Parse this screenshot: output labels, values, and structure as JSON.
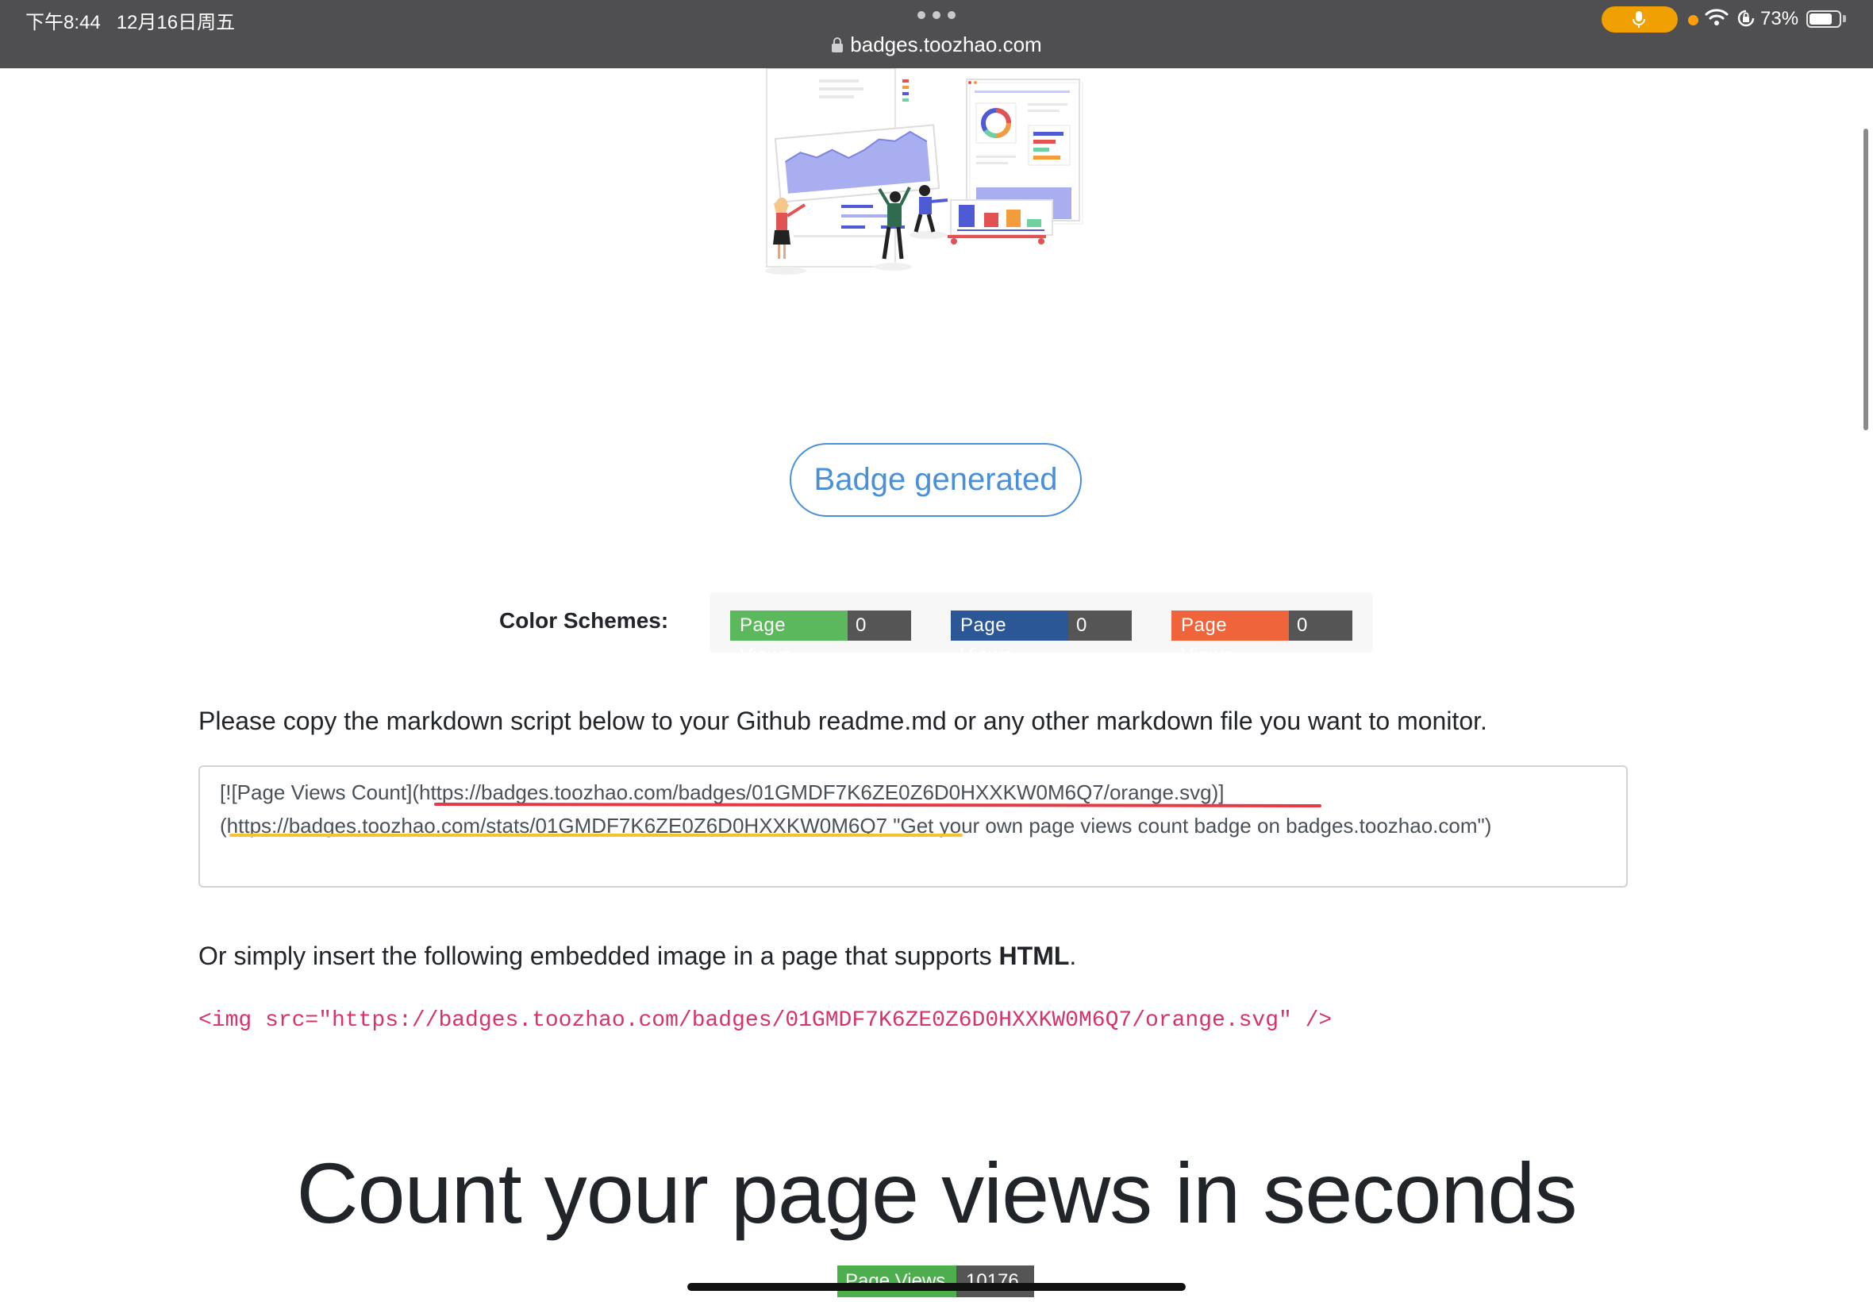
{
  "status_bar": {
    "time": "下午8:44   12月16日周五",
    "url": "badges.toozhao.com",
    "battery_percent": "73%",
    "battery_level": 0.73,
    "icons": [
      "lock-icon",
      "microphone-icon",
      "wifi-icon",
      "rotation-lock-icon",
      "battery-icon"
    ]
  },
  "main": {
    "badge_generated_button": "Badge generated",
    "color_schemes": {
      "label": "Color Schemes:",
      "badges": [
        {
          "label": "Page Views",
          "value": "0",
          "color": "#5cb85c"
        },
        {
          "label": "Page Views",
          "value": "0",
          "color": "#2b5797"
        },
        {
          "label": "Page Views",
          "value": "0",
          "color": "#f0643c"
        }
      ]
    },
    "markdown_instructions": "Please copy the markdown script below to your Github readme.md or any other markdown file you want to monitor.",
    "markdown_code": {
      "line1": "[![Page Views Count](https://badges.toozhao.com/badges/01GMDF7K6ZE0Z6D0HXXKW0M6Q7/orange.svg)]",
      "line2": "(https://badges.toozhao.com/stats/01GMDF7K6ZE0Z6D0HXXKW0M6Q7 \"Get your own page views count badge on badges.toozhao.com\")"
    },
    "html_instructions_prefix": "Or simply insert the following embedded image in a page that supports ",
    "html_instructions_bold": "HTML",
    "html_instructions_suffix": ".",
    "html_code": "<img src=\"https://badges.toozhao.com/badges/01GMDF7K6ZE0Z6D0HXXKW0M6Q7/orange.svg\" />",
    "headline": "Count your page views in seconds",
    "bottom_badge": {
      "label": "Page Views",
      "value": "10176"
    }
  },
  "colors": {
    "accent_blue": "#4a90d9",
    "status_bar_bg": "#4f4f51",
    "code_pink": "#d6336c",
    "badge_value_bg": "#555555",
    "underline_red": "#e63946",
    "underline_yellow": "#f4c430"
  }
}
